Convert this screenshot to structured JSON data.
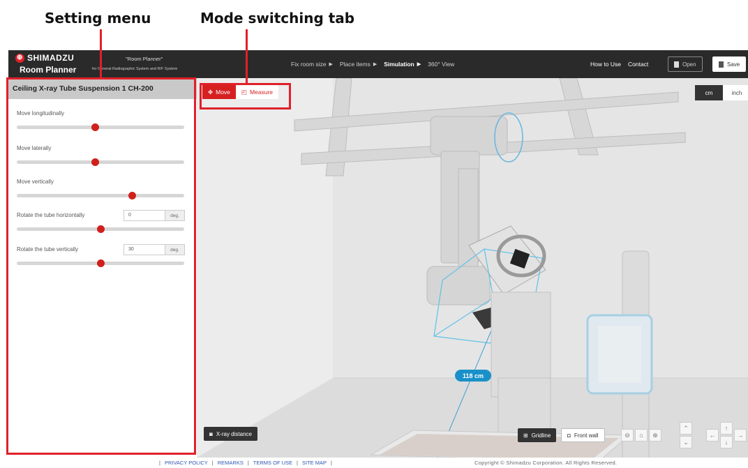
{
  "callouts": {
    "setting_menu": "Setting menu",
    "mode_switching": "Mode switching tab"
  },
  "brand": {
    "company": "SHIMADZU",
    "app_name": "Room Planner",
    "product_title": "\"Room Planner\"",
    "product_desc": "for General Radiographic System and R/F System"
  },
  "steps": [
    {
      "label": "Fix room size",
      "active": false
    },
    {
      "label": "Place items",
      "active": false
    },
    {
      "label": "Simulation",
      "active": true
    },
    {
      "label": "360° View",
      "active": false
    }
  ],
  "top_links": [
    "How to Use",
    "Contact"
  ],
  "top_buttons": {
    "open": "Open",
    "save": "Save"
  },
  "panel": {
    "title": "Ceiling X-ray Tube Suspension 1 CH-200",
    "controls": [
      {
        "label": "Move longitudinally",
        "value_fraction": 0.47
      },
      {
        "label": "Move laterally",
        "value_fraction": 0.47
      },
      {
        "label": "Move vertically",
        "value_fraction": 0.69
      },
      {
        "label": "Rotate the tube horizontally",
        "input": "0",
        "unit": "deg.",
        "value_fraction": 0.5
      },
      {
        "label": "Rotate the tube vertically",
        "input": "30",
        "unit": "deg.",
        "value_fraction": 0.5
      }
    ]
  },
  "viewport": {
    "mode_tabs": {
      "move": "Move",
      "measure": "Measure",
      "active": "move"
    },
    "units": {
      "cm": "cm",
      "inch": "inch",
      "active": "cm"
    },
    "distance_label": "118 cm",
    "xray_distance": "X-ray distance",
    "gridline": "Gridline",
    "front_wall": "Front wall"
  },
  "colors": {
    "accent_red": "#d62020",
    "measure_blue": "#1a90c8",
    "topbar": "#2a2a2a"
  },
  "footer": {
    "links": [
      "PRIVACY POLICY",
      "REMARKS",
      "TERMS OF USE",
      "SITE MAP"
    ],
    "copyright": "Copyright © Shimadzu Corporation. All Rights Reserved."
  }
}
